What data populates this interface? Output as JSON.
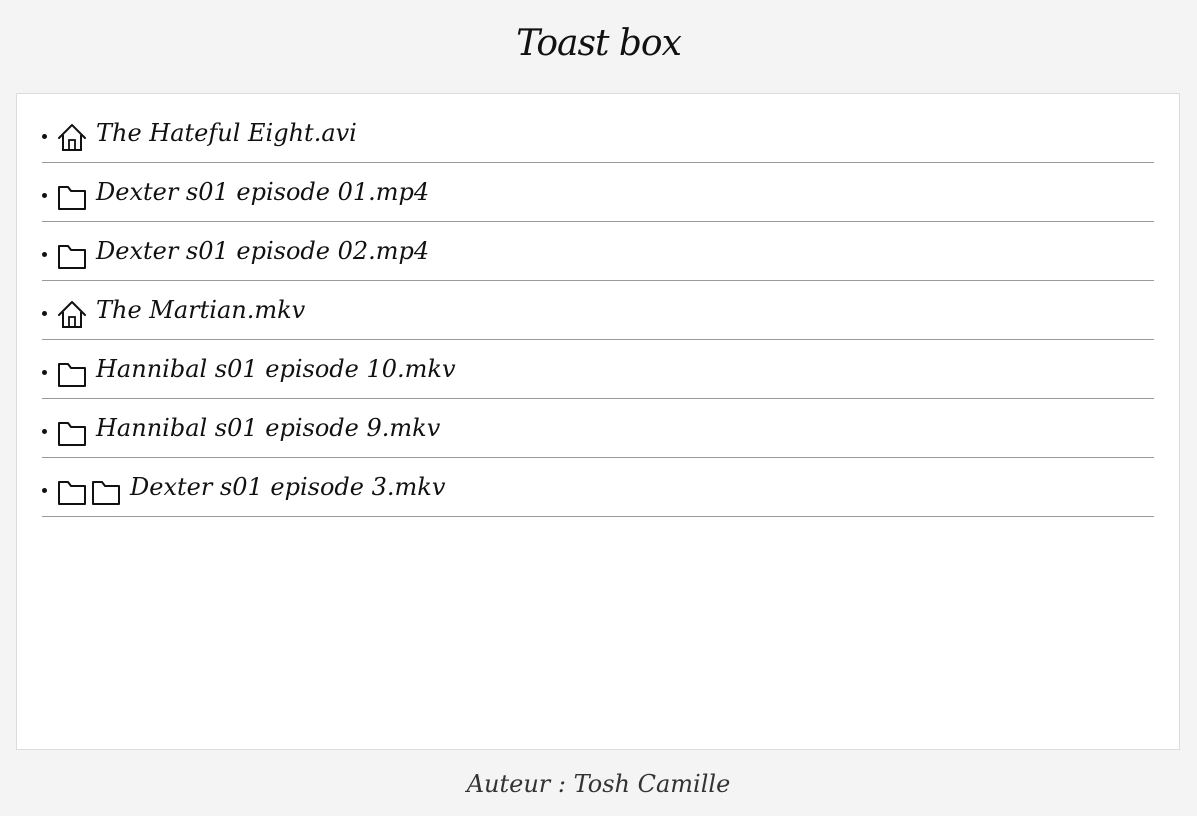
{
  "header": {
    "title": "Toast box"
  },
  "files": [
    {
      "icons": [
        "house-icon"
      ],
      "name": "The Hateful Eight.avi"
    },
    {
      "icons": [
        "folder-icon"
      ],
      "name": "Dexter s01 episode 01.mp4"
    },
    {
      "icons": [
        "folder-icon"
      ],
      "name": "Dexter s01 episode 02.mp4"
    },
    {
      "icons": [
        "house-icon"
      ],
      "name": "The Martian.mkv"
    },
    {
      "icons": [
        "folder-icon"
      ],
      "name": "Hannibal s01 episode 10.mkv"
    },
    {
      "icons": [
        "folder-icon"
      ],
      "name": "Hannibal s01 episode 9.mkv"
    },
    {
      "icons": [
        "folder-icon",
        "folder-icon"
      ],
      "name": "Dexter s01 episode 3.mkv"
    }
  ],
  "footer": {
    "author": "Auteur : Tosh Camille"
  }
}
